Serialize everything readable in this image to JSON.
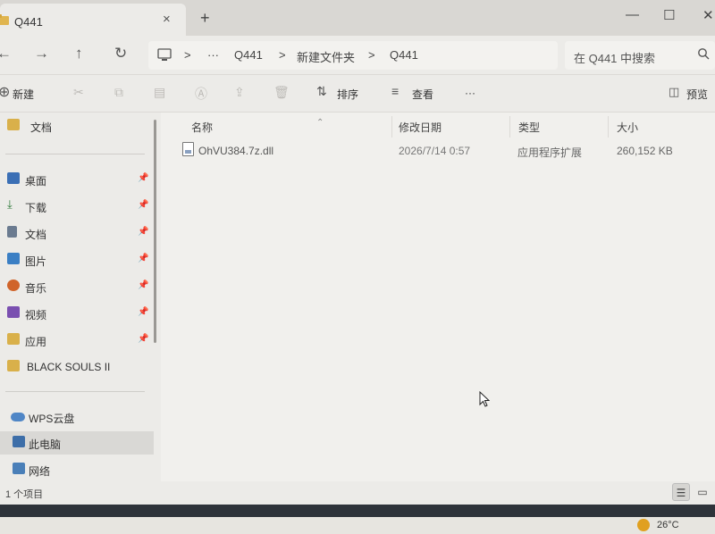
{
  "tab": {
    "title": "Q441",
    "close": "×",
    "new_tab": "+"
  },
  "window": {
    "minimize": "—",
    "maximize": "☐",
    "close": "✕"
  },
  "nav": {
    "back": "←",
    "forward": "→",
    "up": "↑",
    "refresh": "↻"
  },
  "address": {
    "more": "···",
    "segments": [
      "Q441",
      "新建文件夹",
      "Q441"
    ],
    "separator": ">"
  },
  "search": {
    "placeholder": "在 Q441 中搜索"
  },
  "toolbar": {
    "new_label": "新建",
    "sort_label": "排序",
    "view_label": "查看",
    "more": "···",
    "preview_label": "预览"
  },
  "sidebar": {
    "top_item": {
      "label": "文档"
    },
    "pinned": [
      {
        "label": "桌面",
        "icon": "desktop-icon",
        "color": "#3b6fb5"
      },
      {
        "label": "下载",
        "icon": "download-icon",
        "color": "#2f7a3a"
      },
      {
        "label": "文档",
        "icon": "document-icon",
        "color": "#6b7b90"
      },
      {
        "label": "图片",
        "icon": "pictures-icon",
        "color": "#3b7fc4"
      },
      {
        "label": "音乐",
        "icon": "music-icon",
        "color": "#d0642a"
      },
      {
        "label": "视频",
        "icon": "video-icon",
        "color": "#7a4fb0"
      },
      {
        "label": "应用",
        "icon": "folder-icon",
        "color": "#d9b04a"
      }
    ],
    "folder_item": {
      "label": "BLACK SOULS II"
    },
    "cloud_item": {
      "label": "WPS云盘"
    },
    "pc_item": {
      "label": "此电脑"
    },
    "network_item": {
      "label": "网络"
    },
    "pin_glyph": "📌"
  },
  "columns": {
    "name": "名称",
    "modified": "修改日期",
    "type": "类型",
    "size": "大小"
  },
  "files": [
    {
      "name": "OhVU384.7z.dll",
      "modified": "2026/7/14 0:57",
      "type": "应用程序扩展",
      "size": "260,152 KB"
    }
  ],
  "status": {
    "count_text": "1 个项目"
  },
  "taskbar": {
    "temperature": "26°C"
  }
}
